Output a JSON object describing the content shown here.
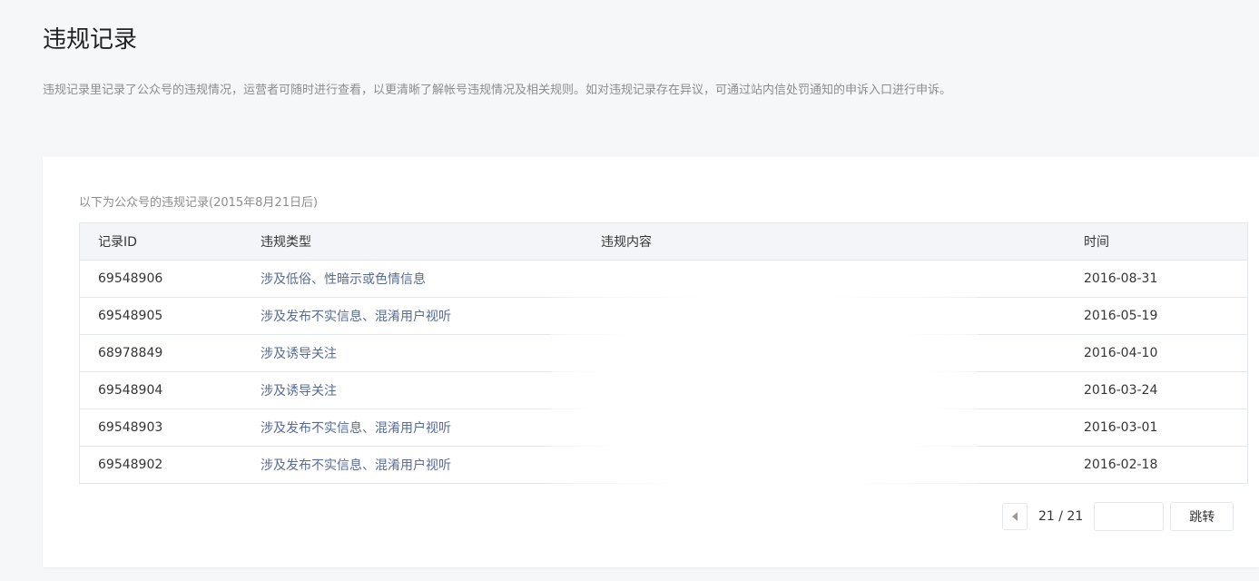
{
  "page": {
    "title": "违规记录",
    "description": "违规记录里记录了公众号的违规情况，运营者可随时进行查看，以更清晰了解帐号违规情况及相关规则。如对违规记录存在异议，可通过站内信处罚通知的申诉入口进行申诉。"
  },
  "table": {
    "caption": "以下为公众号的违规记录(2015年8月21日后)",
    "headers": {
      "id": "记录ID",
      "type": "违规类型",
      "content": "违规内容",
      "time": "时间"
    },
    "rows": [
      {
        "id": "69548906",
        "type": "涉及低俗、性暗示或色情信息",
        "content": "",
        "time": "2016-08-31"
      },
      {
        "id": "69548905",
        "type": "涉及发布不实信息、混淆用户视听",
        "content": "",
        "time": "2016-05-19"
      },
      {
        "id": "68978849",
        "type": "涉及诱导关注",
        "content": "",
        "time": "2016-04-10"
      },
      {
        "id": "69548904",
        "type": "涉及诱导关注",
        "content": "",
        "time": "2016-03-24"
      },
      {
        "id": "69548903",
        "type": "涉及发布不实信息、混淆用户视听",
        "content": "",
        "time": "2016-03-01"
      },
      {
        "id": "69548902",
        "type": "涉及发布不实信息、混淆用户视听",
        "content": "",
        "time": "2016-02-18"
      }
    ]
  },
  "pagination": {
    "indicator": "21 / 21",
    "input_value": "",
    "jump_label": "跳转"
  }
}
